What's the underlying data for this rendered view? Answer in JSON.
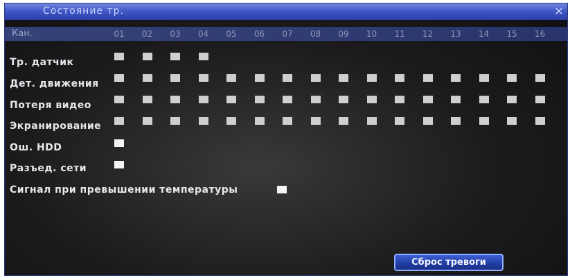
{
  "window": {
    "title": "Состояние тр.",
    "close_symbol": "×"
  },
  "header": {
    "label": "Кан.",
    "channels": [
      "01",
      "02",
      "03",
      "04",
      "05",
      "06",
      "07",
      "08",
      "09",
      "10",
      "11",
      "12",
      "13",
      "14",
      "15",
      "16"
    ]
  },
  "rows": [
    {
      "label": "Тр. датчик",
      "cells": 4
    },
    {
      "label": "Дет. движения",
      "cells": 16
    },
    {
      "label": "Потеря видео",
      "cells": 16
    },
    {
      "label": "Экранирование",
      "cells": 16
    },
    {
      "label": "Ош. HDD",
      "cells": 1
    },
    {
      "label": "Разъед. сети",
      "cells": 1
    }
  ],
  "temperature_alarm": {
    "label": "Сигнал при превышении температуры"
  },
  "footer": {
    "reset_label": "Сброс тревоги"
  },
  "colors": {
    "title_bar": "#3e55c4",
    "indicator": "#cfcfd2",
    "button": "#203ca0"
  }
}
